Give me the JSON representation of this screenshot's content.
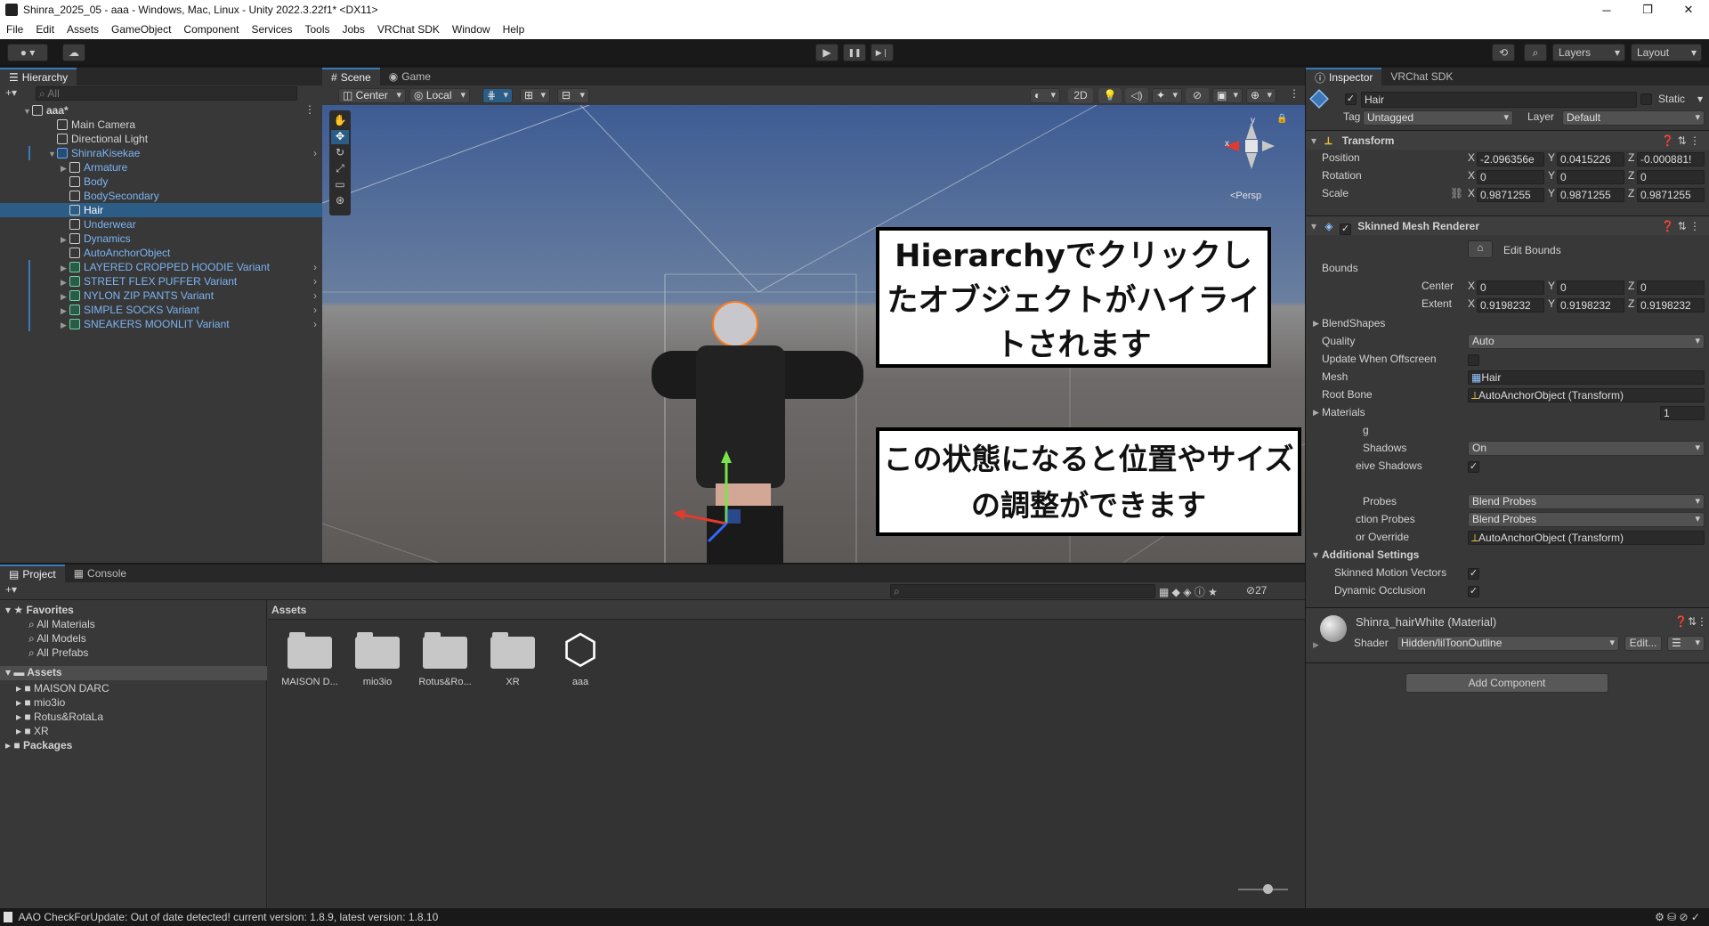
{
  "window": {
    "title": "Shinra_2025_05 - aaa - Windows, Mac, Linux - Unity 2022.3.22f1* <DX11>",
    "controls": [
      "─",
      "❐",
      "✕"
    ]
  },
  "menu": [
    "File",
    "Edit",
    "Assets",
    "GameObject",
    "Component",
    "Services",
    "Tools",
    "Jobs",
    "VRChat SDK",
    "Window",
    "Help"
  ],
  "toolbar": {
    "play_icons": [
      "▶",
      "❚❚",
      "▶❘"
    ],
    "layers": "Layers",
    "layout": "Layout"
  },
  "hierarchy": {
    "tab": "Hierarchy",
    "search_placeholder": "All",
    "items": [
      {
        "label": "aaa*",
        "indent": 0,
        "style": "scene"
      },
      {
        "label": "Main Camera",
        "indent": 1,
        "style": "normal"
      },
      {
        "label": "Directional Light",
        "indent": 1,
        "style": "normal"
      },
      {
        "label": "ShinraKisekae",
        "indent": 1,
        "style": "prefab"
      },
      {
        "label": "Armature",
        "indent": 2,
        "style": "prefab"
      },
      {
        "label": "Body",
        "indent": 2,
        "style": "prefab"
      },
      {
        "label": "BodySecondary",
        "indent": 2,
        "style": "prefab"
      },
      {
        "label": "Hair",
        "indent": 2,
        "style": "selected"
      },
      {
        "label": "Underwear",
        "indent": 2,
        "style": "prefab"
      },
      {
        "label": "Dynamics",
        "indent": 2,
        "style": "prefab"
      },
      {
        "label": "AutoAnchorObject",
        "indent": 2,
        "style": "prefab"
      },
      {
        "label": "LAYERED CROPPED HOODIE Variant",
        "indent": 2,
        "style": "variant"
      },
      {
        "label": "STREET FLEX PUFFER Variant",
        "indent": 2,
        "style": "variant"
      },
      {
        "label": "NYLON ZIP PANTS Variant",
        "indent": 2,
        "style": "variant"
      },
      {
        "label": "SIMPLE SOCKS Variant",
        "indent": 2,
        "style": "variant"
      },
      {
        "label": "SNEAKERS MOONLIT Variant",
        "indent": 2,
        "style": "variant"
      }
    ]
  },
  "scene": {
    "tabs": [
      "Scene",
      "Game"
    ],
    "pivot": "Center",
    "space": "Local",
    "mode_2d": "2D",
    "persp": "<Persp",
    "gizmo_x": "x",
    "gizmo_y": "y"
  },
  "callouts": {
    "top": "Hierarchyでクリックしたオブジェクトがハイライトされます",
    "bottom": "この状態になると位置やサイズの調整ができます"
  },
  "inspector": {
    "tabs": [
      "Inspector",
      "VRChat SDK"
    ],
    "object_name": "Hair",
    "static_label": "Static",
    "tag_label": "Tag",
    "tag_value": "Untagged",
    "layer_label": "Layer",
    "layer_value": "Default",
    "transform": {
      "title": "Transform",
      "position": {
        "label": "Position",
        "x": "-2.096356e",
        "y": "0.0415226",
        "z": "-0.000881!"
      },
      "rotation": {
        "label": "Rotation",
        "x": "0",
        "y": "0",
        "z": "0"
      },
      "scale": {
        "label": "Scale",
        "x": "0.9871255",
        "y": "0.9871255",
        "z": "0.9871255"
      }
    },
    "smr": {
      "title": "Skinned Mesh Renderer",
      "edit_bounds": "Edit Bounds",
      "bounds": "Bounds",
      "center": {
        "label": "Center",
        "x": "0",
        "y": "0",
        "z": "0"
      },
      "extent": {
        "label": "Extent",
        "x": "0.9198232",
        "y": "0.9198232",
        "z": "0.9198232"
      },
      "blendshapes": "BlendShapes",
      "quality_label": "Quality",
      "quality_value": "Auto",
      "update_offscreen": "Update When Offscreen",
      "mesh_label": "Mesh",
      "mesh_value": "Hair",
      "root_bone_label": "Root Bone",
      "root_bone_value": "AutoAnchorObject (Transform)",
      "materials_label": "Materials",
      "materials_count": "1",
      "lighting_label": "g",
      "cast_shadows_label": "Shadows",
      "cast_shadows_value": "On",
      "receive_shadows_label": "eive Shadows",
      "light_probes_label": "Probes",
      "light_probes_value": "Blend Probes",
      "reflection_probes_label": "ction Probes",
      "reflection_probes_value": "Blend Probes",
      "anchor_override_label": "or Override",
      "anchor_override_value": "AutoAnchorObject (Transform)",
      "additional_settings": "Additional Settings",
      "skinned_motion_vectors": "Skinned Motion Vectors",
      "dynamic_occlusion": "Dynamic Occlusion"
    },
    "material": {
      "name": "Shinra_hairWhite (Material)",
      "shader_label": "Shader",
      "shader_value": "Hidden/lilToonOutline",
      "edit_label": "Edit..."
    },
    "add_component": "Add Component"
  },
  "project": {
    "tabs": [
      "Project",
      "Console"
    ],
    "favorites": "Favorites",
    "fav_items": [
      "All Materials",
      "All Models",
      "All Prefabs"
    ],
    "assets": "Assets",
    "asset_tree": [
      "MAISON DARC",
      "mio3io",
      "Rotus&RotaLa",
      "XR"
    ],
    "packages": "Packages",
    "breadcrumb": "Assets",
    "grid": [
      {
        "label": "MAISON D...",
        "kind": "folder"
      },
      {
        "label": "mio3io",
        "kind": "folder"
      },
      {
        "label": "Rotus&Ro...",
        "kind": "folder"
      },
      {
        "label": "XR",
        "kind": "folder"
      },
      {
        "label": "aaa",
        "kind": "unity"
      }
    ],
    "hidden_count": "27"
  },
  "status": {
    "message": "AAO CheckForUpdate: Out of date detected! current version: 1.8.9, latest version: 1.8.10"
  }
}
